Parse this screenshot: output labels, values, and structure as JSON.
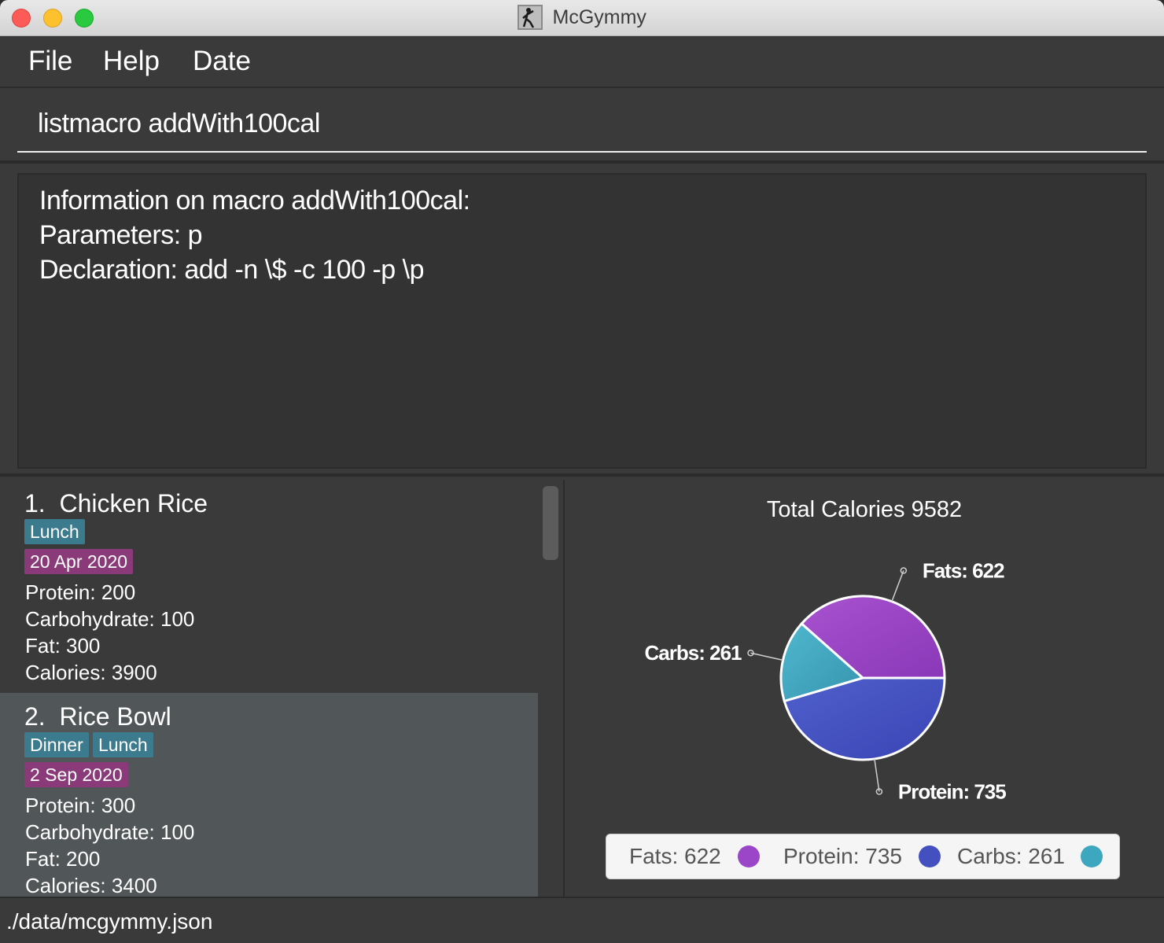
{
  "window": {
    "title": "McGymmy"
  },
  "menu": {
    "file": "File",
    "help": "Help",
    "date": "Date"
  },
  "command": {
    "value": "listmacro addWith100cal"
  },
  "result": {
    "lines": [
      "Information on macro addWith100cal:",
      "Parameters: p",
      "Declaration: add -n \\$ -c 100 -p \\p"
    ]
  },
  "foods": [
    {
      "index": "1.",
      "name": "Chicken Rice",
      "tags": [
        "Lunch"
      ],
      "date": "20 Apr 2020",
      "protein": "Protein: 200",
      "carbohydrate": "Carbohydrate: 100",
      "fat": "Fat: 300",
      "calories": "Calories: 3900"
    },
    {
      "index": "2.",
      "name": "Rice Bowl",
      "tags": [
        "Dinner",
        "Lunch"
      ],
      "date": "2 Sep 2020",
      "protein": "Protein: 300",
      "carbohydrate": "Carbohydrate: 100",
      "fat": "Fat: 200",
      "calories": "Calories: 3400"
    }
  ],
  "chart_data": {
    "type": "pie",
    "title": "Total Calories 9582",
    "slices": [
      {
        "label": "Fats: 622",
        "name": "Fats",
        "value": 622,
        "color": "#9b45c8"
      },
      {
        "label": "Carbs: 261",
        "name": "Carbs",
        "value": 261,
        "color": "#3ea7c0"
      },
      {
        "label": "Protein: 735",
        "name": "Protein",
        "value": 735,
        "color": "#4450c0"
      }
    ],
    "legend_position": "bottom",
    "legend": [
      "Fats: 622",
      "Protein: 735",
      "Carbs: 261"
    ]
  },
  "status": {
    "path": "./data/mcgymmy.json"
  }
}
